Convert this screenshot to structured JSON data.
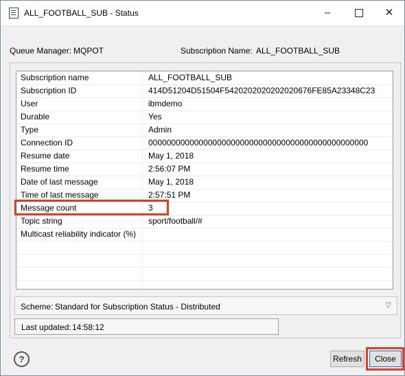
{
  "window": {
    "title": "ALL_FOOTBALL_SUB - Status",
    "min_icon": "–",
    "close_icon": "✕"
  },
  "header": {
    "queue_manager_label": "Queue Manager:",
    "queue_manager_value": "MQPOT",
    "subscription_name_label": "Subscription Name:",
    "subscription_name_value": "ALL_FOOTBALL_SUB"
  },
  "table": {
    "rows": [
      {
        "name": "Subscription name",
        "value": "ALL_FOOTBALL_SUB"
      },
      {
        "name": "Subscription ID",
        "value": "414D51204D51504F5420202020202020676FE85A23348C23"
      },
      {
        "name": "User",
        "value": "ibmdemo"
      },
      {
        "name": "Durable",
        "value": "Yes"
      },
      {
        "name": "Type",
        "value": "Admin"
      },
      {
        "name": "Connection ID",
        "value": "000000000000000000000000000000000000000000000000"
      },
      {
        "name": "Resume date",
        "value": "May 1, 2018"
      },
      {
        "name": "Resume time",
        "value": "2:56:07 PM"
      },
      {
        "name": "Date of last message",
        "value": "May 1, 2018"
      },
      {
        "name": "Time of last message",
        "value": "2:57:51 PM"
      },
      {
        "name": "Message count",
        "value": "3"
      },
      {
        "name": "Topic string",
        "value": "sport/football/#"
      },
      {
        "name": "Multicast reliability indicator (%)",
        "value": ""
      }
    ]
  },
  "scheme": {
    "label": "Scheme:",
    "value": "Standard for Subscription Status - Distributed",
    "dropdown_icon": "▽"
  },
  "status": {
    "last_updated_label": "Last updated:",
    "last_updated_value": "14:58:12"
  },
  "footer": {
    "help_icon": "?",
    "refresh_label": "Refresh",
    "close_label": "Close"
  },
  "colors": {
    "highlight": "#e8391f",
    "focus_border": "#0078d7"
  }
}
